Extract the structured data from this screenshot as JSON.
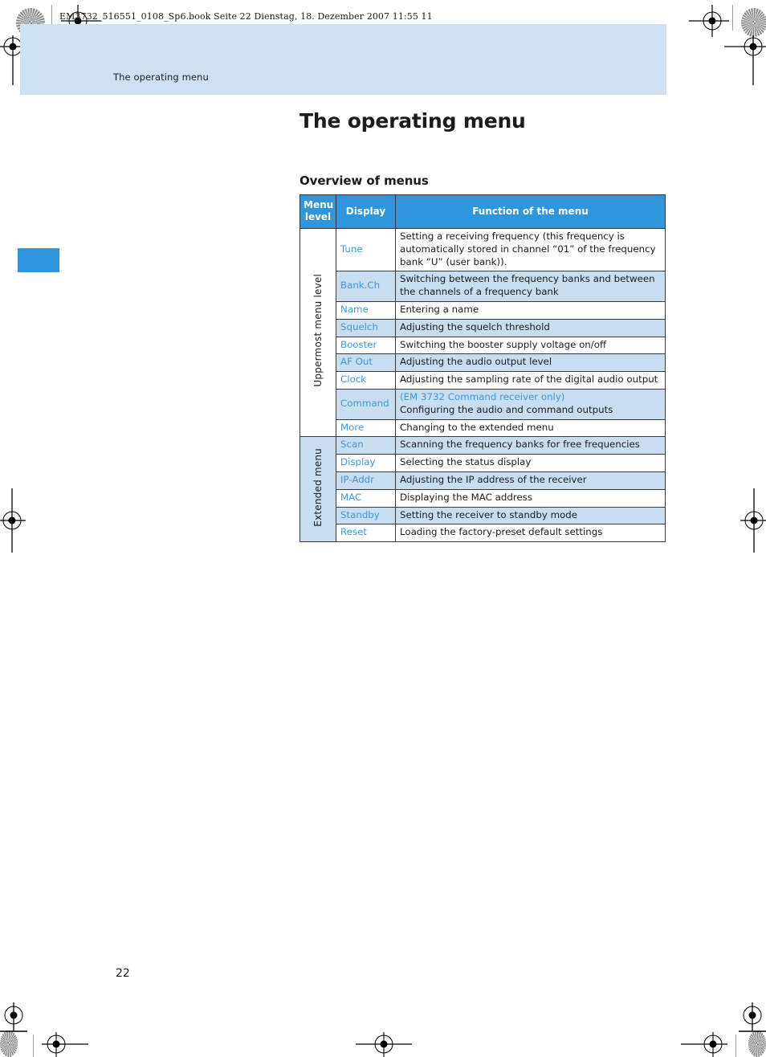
{
  "page": {
    "file_stamp": "EM3732_516551_0108_Sp6.book  Seite 22  Dienstag, 18. Dezember 2007  11:55 11",
    "running_head": "The operating menu",
    "folio": "22",
    "title": "The operating menu",
    "subtitle": "Overview of menus",
    "colors": {
      "accent_blue": "#2f96de",
      "link_blue": "#3d9ade",
      "row_shade": "#c8ddf0",
      "header_band": "#cfe0f2"
    }
  },
  "table": {
    "headers": [
      "Menu level",
      "Display",
      "Function of the menu"
    ],
    "header_level_line1": "Menu",
    "header_level_line2": "level",
    "groups": [
      {
        "level_label": "Uppermost menu level",
        "level_shaded": false,
        "rows": [
          {
            "display": "Tune",
            "function": "Setting a receiving frequency (this frequency is automatically stored in channel “01” of the frequency bank “U” (user bank)).",
            "shaded": false
          },
          {
            "display": "Bank.Ch",
            "function": "Switching between the frequency banks and between the channels of a frequency bank",
            "shaded": true
          },
          {
            "display": "Name",
            "function": "Entering a name",
            "shaded": false
          },
          {
            "display": "Squelch",
            "function": "Adjusting the squelch threshold",
            "shaded": true
          },
          {
            "display": "Booster",
            "function": "Switching the booster supply voltage on/off",
            "shaded": false
          },
          {
            "display": "AF Out",
            "function": "Adjusting the audio output level",
            "shaded": true
          },
          {
            "display": "Clock",
            "function": "Adjusting the sampling rate of the digital audio output",
            "shaded": false
          },
          {
            "display": "Command",
            "function_note": "(EM 3732 Command receiver only)",
            "function": "Configuring the audio and command outputs",
            "shaded": true
          },
          {
            "display": "More",
            "function": "Changing to the extended menu",
            "shaded": false
          }
        ]
      },
      {
        "level_label": "Extended menu",
        "level_shaded": true,
        "rows": [
          {
            "display": "Scan",
            "function": "Scanning the frequency banks for free frequencies",
            "shaded": true
          },
          {
            "display": "Display",
            "function": "Selecting the status display",
            "shaded": false
          },
          {
            "display": "IP-Addr",
            "function": "Adjusting the IP address of the receiver",
            "shaded": true
          },
          {
            "display": "MAC",
            "function": "Displaying the MAC address",
            "shaded": false
          },
          {
            "display": "Standby",
            "function": "Setting the receiver to standby mode",
            "shaded": true
          },
          {
            "display": "Reset",
            "function": "Loading the factory-preset default settings",
            "shaded": false
          }
        ]
      }
    ]
  }
}
